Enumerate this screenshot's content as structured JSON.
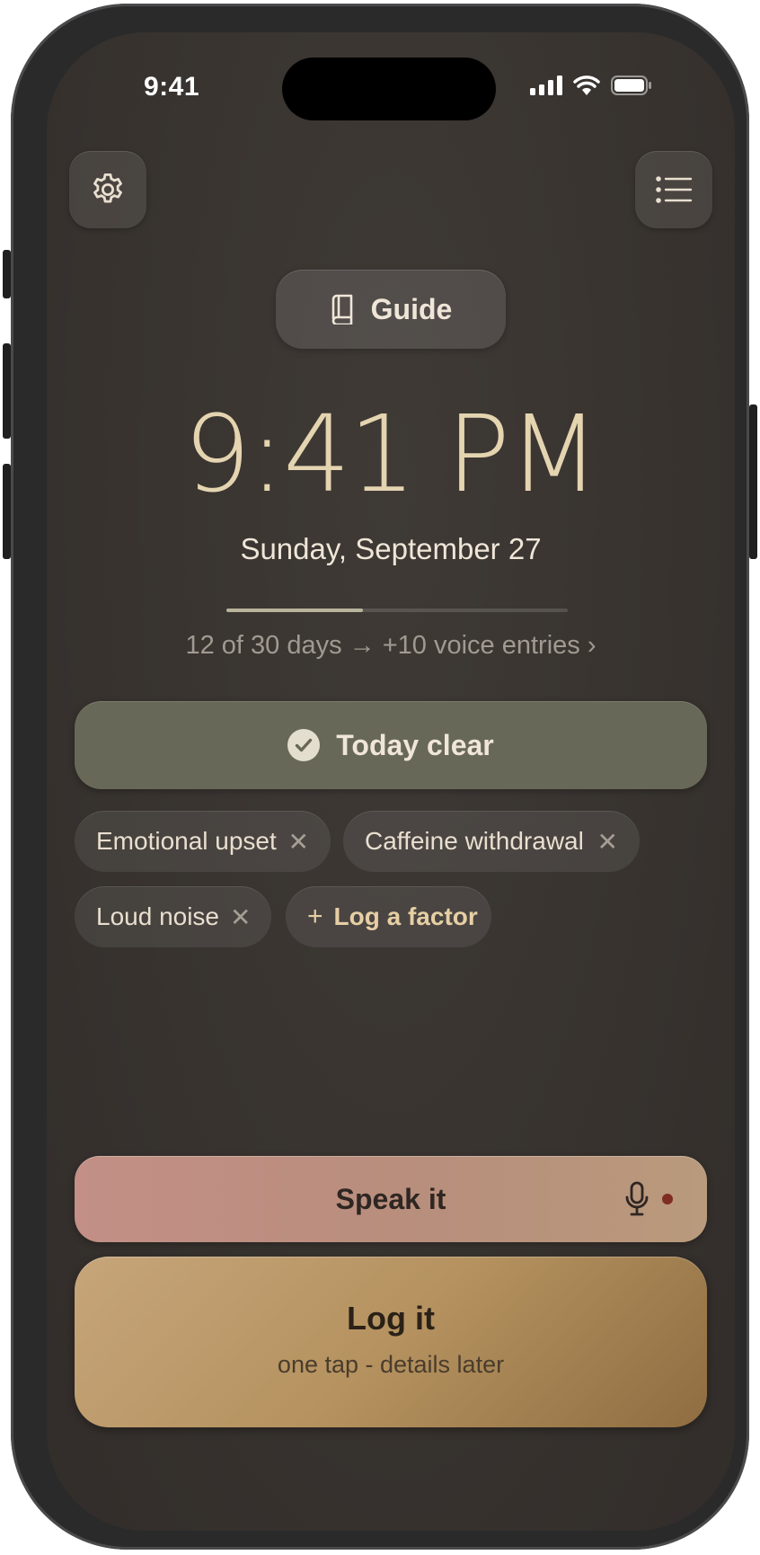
{
  "status_bar": {
    "time": "9:41"
  },
  "header": {
    "settings_icon": "gear-icon",
    "list_icon": "list-icon"
  },
  "guide": {
    "label": "Guide",
    "icon": "book-icon"
  },
  "clock": {
    "time": "9:41 PM",
    "date": "Sunday, September 27"
  },
  "progress": {
    "text": "12 of 30 days → +10 voice entries ›",
    "current_days": 12,
    "total_days": 30,
    "fraction": 0.4
  },
  "today": {
    "label": "Today clear",
    "icon": "check-circle-icon"
  },
  "factors": [
    {
      "label": "Emotional upset"
    },
    {
      "label": "Caffeine withdrawal"
    },
    {
      "label": "Loud noise"
    }
  ],
  "add_factor": {
    "label": "Log a factor"
  },
  "speak": {
    "label": "Speak it",
    "icon": "microphone-icon"
  },
  "log": {
    "title": "Log it",
    "subtitle": "one tap - details later"
  },
  "colors": {
    "background": "#38332f",
    "accent_text": "#e4d4b0",
    "today_card": "#686858",
    "speak_button": "#c38f86",
    "log_button": "#b5925f"
  }
}
